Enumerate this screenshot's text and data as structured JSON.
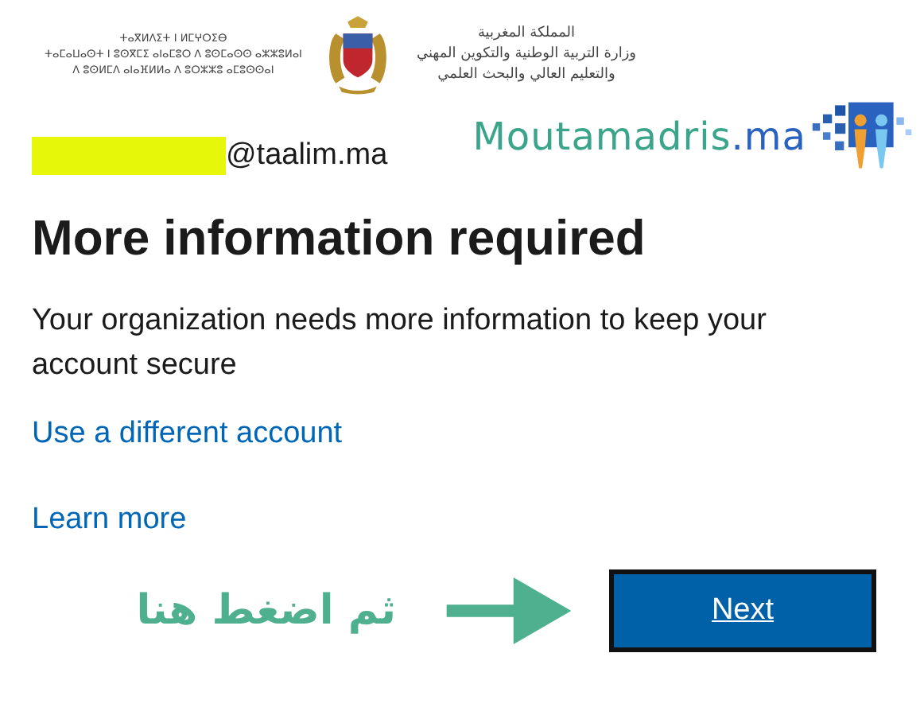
{
  "header": {
    "tifinagh_lines": [
      "ⵜⴰⴳⵍⴷⵉⵜ ⵏ ⵍⵎⵖⵔⵉⴱ",
      "ⵜⴰⵎⴰⵡⴰⵙⵜ ⵏ ⵓⵙⴳⵎⵉ ⴰⵏⴰⵎⵓⵔ ⴷ ⵓⵙⵎⴰⵙⵙ ⴰⵣⵣⵓⵍⴰⵏ",
      "ⴷ ⵓⵙⵍⵎⴷ ⴰⵏⴰⴼⵍⵍⴰ ⴷ ⵓⵔⵣⵣⵓ ⴰⵎⵓⵙⵙⴰⵏ"
    ],
    "arabic_lines": [
      "المملكة المغربية",
      "وزارة التربية الوطنية والتكوين المهني",
      "والتعليم العالي والبحث العلمي"
    ]
  },
  "account": {
    "redacted": true,
    "email": "@taalim.ma"
  },
  "brand": {
    "name": "Moutamadris",
    "suffix": ".ma"
  },
  "title": "More information required",
  "message": "Your organization needs more information to keep your account secure",
  "links": [
    "Use a different account",
    "Learn more"
  ],
  "hint": "ثم اضغط هنا",
  "button": "Next"
}
